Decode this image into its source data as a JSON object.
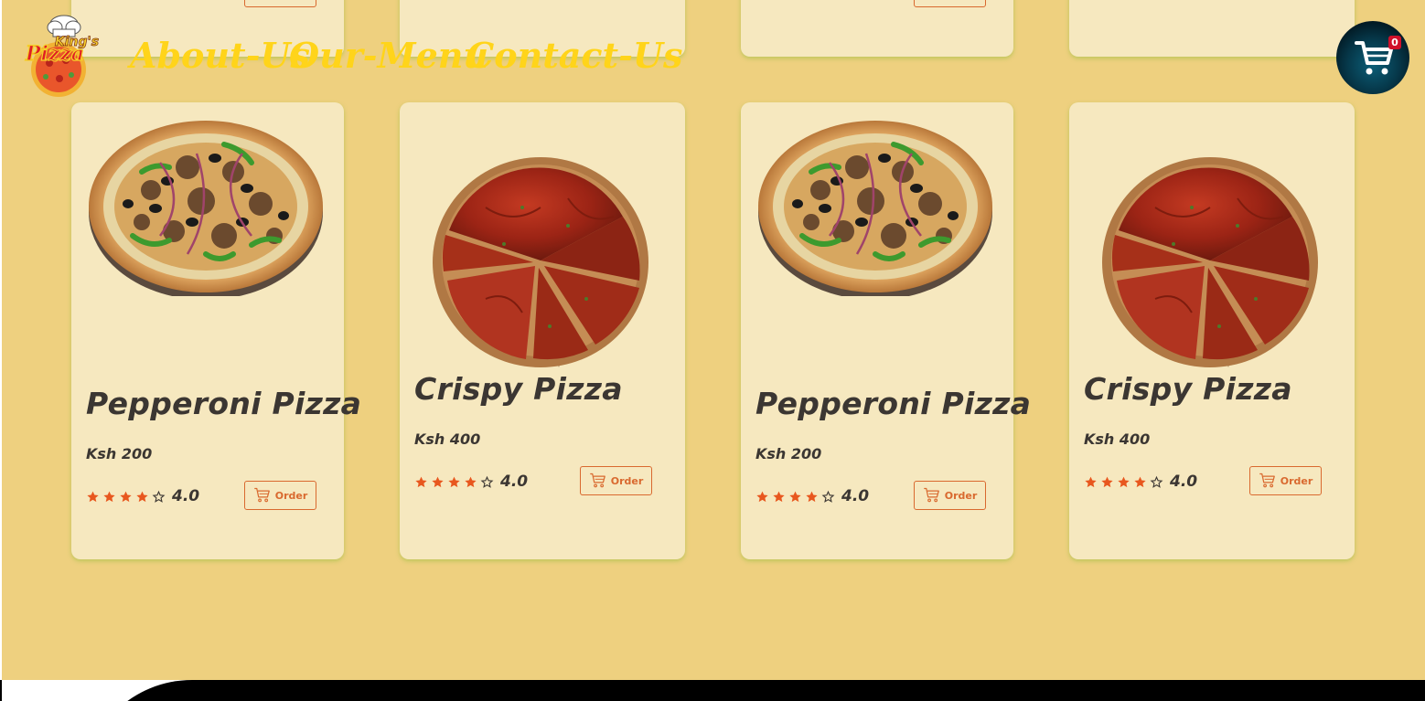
{
  "colors": {
    "page_background": "#eed07f",
    "card_background": "#f6e8bf",
    "nav_link": "#ffd41a",
    "accent_orange": "#d9692f",
    "star": "#e8571e",
    "text_dark": "#3b3632",
    "cart_badge": "#d0102a",
    "footer": "#000000"
  },
  "logo": {
    "text_top": "King's",
    "text_main": "Pizza",
    "icon": "chef-pizza-logo"
  },
  "nav": {
    "links": [
      "About-Us",
      "Our-Menu",
      "Contact-Us"
    ]
  },
  "cart": {
    "icon": "shopping-cart-icon",
    "count": "0"
  },
  "products": [
    {
      "name": "Pepperoni Pizza",
      "price": "Ksh 200",
      "rating": "4.0",
      "stars_filled": 4,
      "stars_total": 5,
      "order_label": "Order",
      "image": "pepperoni-pizza-image"
    },
    {
      "name": "Crispy Pizza",
      "price": "Ksh 400",
      "rating": "4.0",
      "stars_filled": 4,
      "stars_total": 5,
      "order_label": "Order",
      "image": "crispy-pizza-image"
    },
    {
      "name": "Pepperoni Pizza",
      "price": "Ksh 200",
      "rating": "4.0",
      "stars_filled": 4,
      "stars_total": 5,
      "order_label": "Order",
      "image": "pepperoni-pizza-image"
    },
    {
      "name": "Crispy Pizza",
      "price": "Ksh 400",
      "rating": "4.0",
      "stars_filled": 4,
      "stars_total": 5,
      "order_label": "Order",
      "image": "crispy-pizza-image"
    }
  ]
}
